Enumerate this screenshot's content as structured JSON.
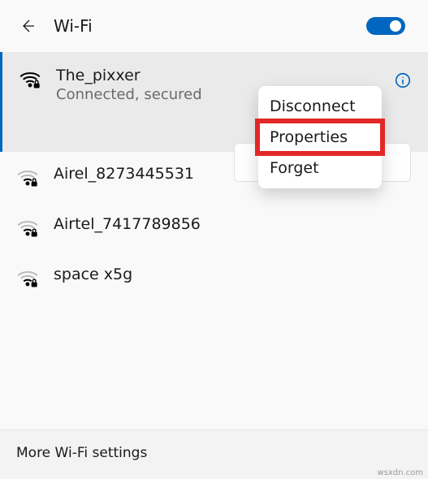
{
  "header": {
    "title": "Wi-Fi",
    "toggle_on": true
  },
  "connected_network": {
    "ssid": "The_pixxer",
    "status": "Connected, secured"
  },
  "context_menu": {
    "items": [
      "Disconnect",
      "Properties",
      "Forget"
    ],
    "highlighted_index": 1
  },
  "other_networks": [
    {
      "ssid": "Airel_8273445531"
    },
    {
      "ssid": "Airtel_7417789856"
    },
    {
      "ssid": "space x5g"
    }
  ],
  "footer": {
    "more_settings": "More Wi-Fi settings"
  },
  "watermark": "wsxdn.com"
}
